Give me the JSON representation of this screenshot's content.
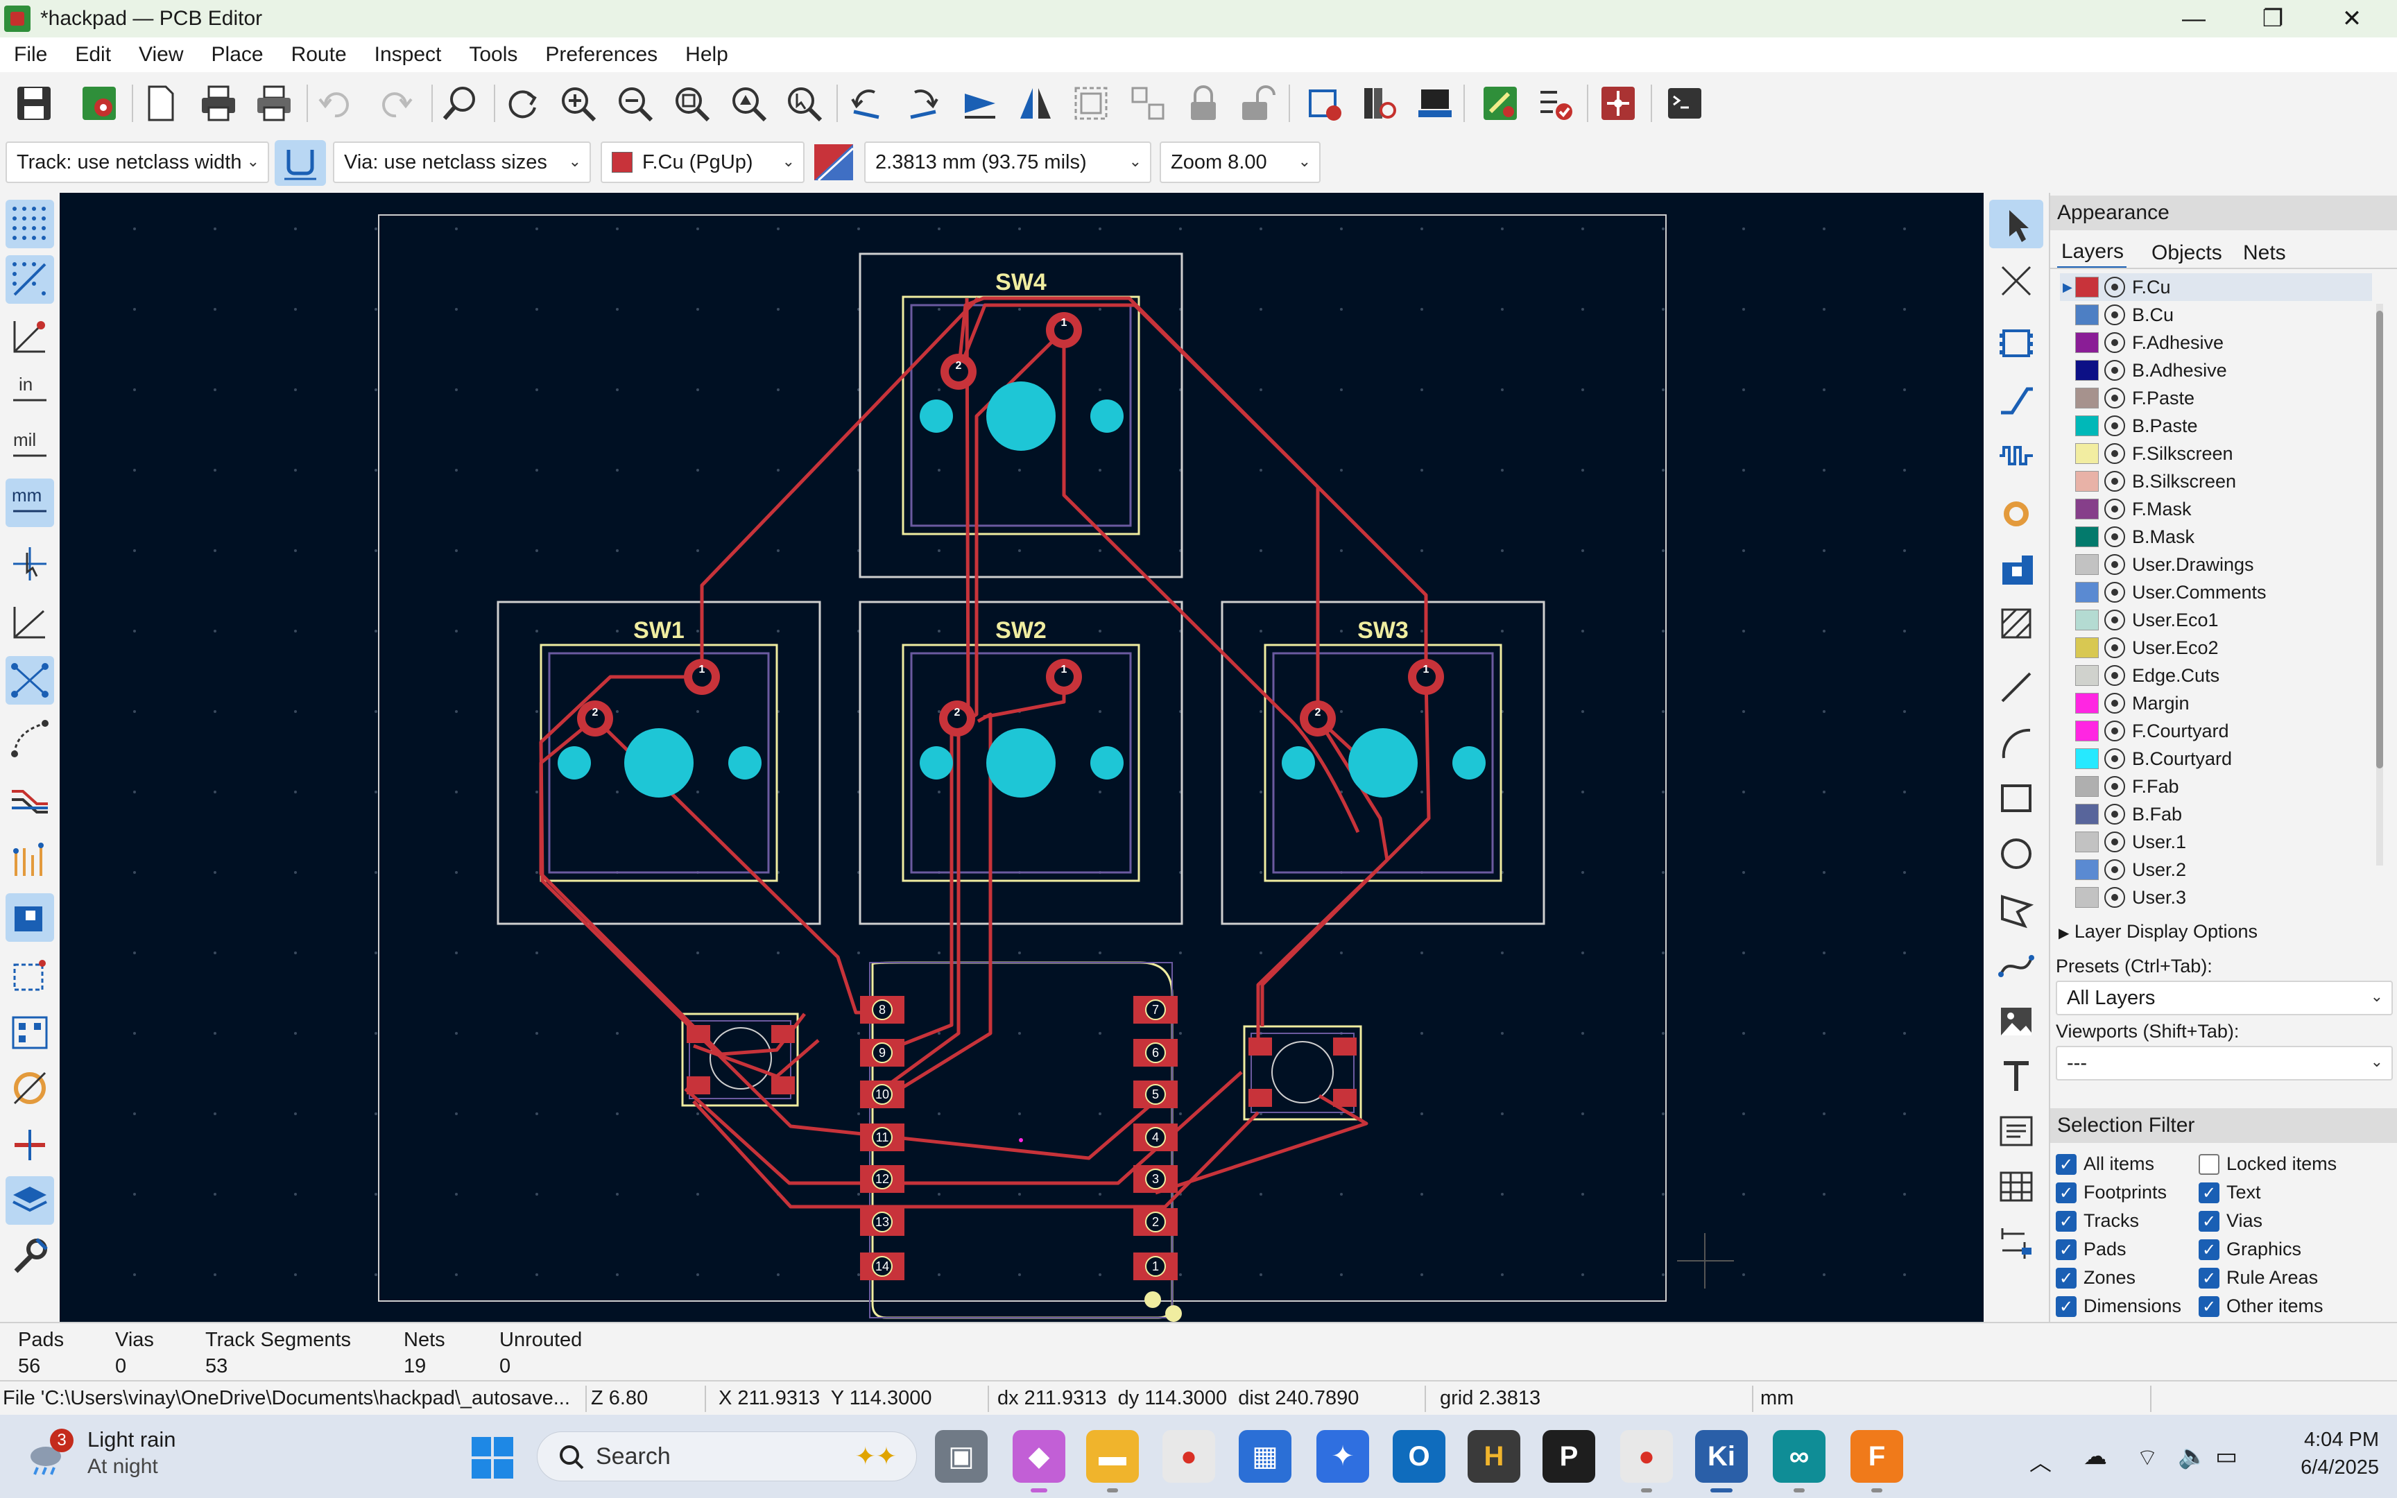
{
  "window": {
    "title": "*hackpad — PCB Editor",
    "minimize": "—",
    "maximize": "❐",
    "close": "✕"
  },
  "menu": [
    "File",
    "Edit",
    "View",
    "Place",
    "Route",
    "Inspect",
    "Tools",
    "Preferences",
    "Help"
  ],
  "toolbar2": {
    "track_width": "Track: use netclass width",
    "via_size": "Via: use netclass sizes",
    "active_layer": "F.Cu (PgUp)",
    "grid": "2.3813 mm (93.75 mils)",
    "zoom": "Zoom 8.00"
  },
  "left_toolbar": {
    "units": {
      "inch": "in",
      "mil": "mil",
      "mm": "mm"
    }
  },
  "board": {
    "switches": [
      {
        "ref": "SW4",
        "pin1": "1",
        "pin2": "2"
      },
      {
        "ref": "SW1",
        "pin1": "1",
        "pin2": "2"
      },
      {
        "ref": "SW2",
        "pin1": "1",
        "pin2": "2"
      },
      {
        "ref": "SW3",
        "pin1": "1",
        "pin2": "2"
      }
    ],
    "mcu_left_pins": [
      "8",
      "9",
      "10",
      "11",
      "12",
      "13",
      "14"
    ],
    "mcu_right_pins": [
      "7",
      "6",
      "5",
      "4",
      "3",
      "2",
      "1"
    ],
    "colors": {
      "background": "#001023",
      "track": "#c8333a",
      "pad": "#c8333a",
      "npth": "#1ec6d6",
      "silkscreen": "#f0eda0",
      "courtyard": "#bdbdbd",
      "fab": "#6b5aa0",
      "edge": "#cfcfcf"
    }
  },
  "appearance": {
    "title": "Appearance",
    "tabs": [
      "Layers",
      "Objects",
      "Nets"
    ],
    "layers": [
      {
        "name": "F.Cu",
        "color": "#c8333a"
      },
      {
        "name": "B.Cu",
        "color": "#4d7fc4"
      },
      {
        "name": "F.Adhesive",
        "color": "#8a1d96"
      },
      {
        "name": "B.Adhesive",
        "color": "#0c1086"
      },
      {
        "name": "F.Paste",
        "color": "#a6928d"
      },
      {
        "name": "B.Paste",
        "color": "#00b8b8"
      },
      {
        "name": "F.Silkscreen",
        "color": "#f2eda1"
      },
      {
        "name": "B.Silkscreen",
        "color": "#e8b2a7"
      },
      {
        "name": "F.Mask",
        "color": "#863f8a"
      },
      {
        "name": "B.Mask",
        "color": "#037a6c"
      },
      {
        "name": "User.Drawings",
        "color": "#c2c2c2"
      },
      {
        "name": "User.Comments",
        "color": "#5a8ad2"
      },
      {
        "name": "User.Eco1",
        "color": "#b4dbd2"
      },
      {
        "name": "User.Eco2",
        "color": "#d8c852"
      },
      {
        "name": "Edge.Cuts",
        "color": "#d0d2cd"
      },
      {
        "name": "Margin",
        "color": "#ff26e2"
      },
      {
        "name": "F.Courtyard",
        "color": "#ff26e2"
      },
      {
        "name": "B.Courtyard",
        "color": "#26e9ff"
      },
      {
        "name": "F.Fab",
        "color": "#afafaf"
      },
      {
        "name": "B.Fab",
        "color": "#58659b"
      },
      {
        "name": "User.1",
        "color": "#c2c2c2"
      },
      {
        "name": "User.2",
        "color": "#5a8ad2"
      },
      {
        "name": "User.3",
        "color": "#c2c2c2"
      }
    ],
    "layer_display_options": "Layer Display Options",
    "presets_label": "Presets (Ctrl+Tab):",
    "presets_value": "All Layers",
    "viewports_label": "Viewports (Shift+Tab):",
    "viewports_value": "---"
  },
  "selection_filter": {
    "title": "Selection Filter",
    "items": [
      {
        "label": "All items",
        "checked": true
      },
      {
        "label": "Locked items",
        "checked": false
      },
      {
        "label": "Footprints",
        "checked": true
      },
      {
        "label": "Text",
        "checked": true
      },
      {
        "label": "Tracks",
        "checked": true
      },
      {
        "label": "Vias",
        "checked": true
      },
      {
        "label": "Pads",
        "checked": true
      },
      {
        "label": "Graphics",
        "checked": true
      },
      {
        "label": "Zones",
        "checked": true
      },
      {
        "label": "Rule Areas",
        "checked": true
      },
      {
        "label": "Dimensions",
        "checked": true
      },
      {
        "label": "Other items",
        "checked": true
      }
    ]
  },
  "stats": {
    "labels": [
      "Pads",
      "Vias",
      "Track Segments",
      "Nets",
      "Unrouted"
    ],
    "values": [
      "56",
      "0",
      "53",
      "19",
      "0"
    ]
  },
  "statusbar": {
    "file": "File 'C:\\Users\\vinay\\OneDrive\\Documents\\hackpad\\_autosave...",
    "z": "Z 6.80",
    "xy": "X 211.9313  Y 114.3000",
    "delta": "dx 211.9313  dy 114.3000  dist 240.7890",
    "grid": "grid 2.3813",
    "units": "mm"
  },
  "taskbar": {
    "weather_badge": "3",
    "weather_title": "Light rain",
    "weather_sub": "At night",
    "search": "Search",
    "time": "4:04 PM",
    "date": "6/4/2025"
  }
}
